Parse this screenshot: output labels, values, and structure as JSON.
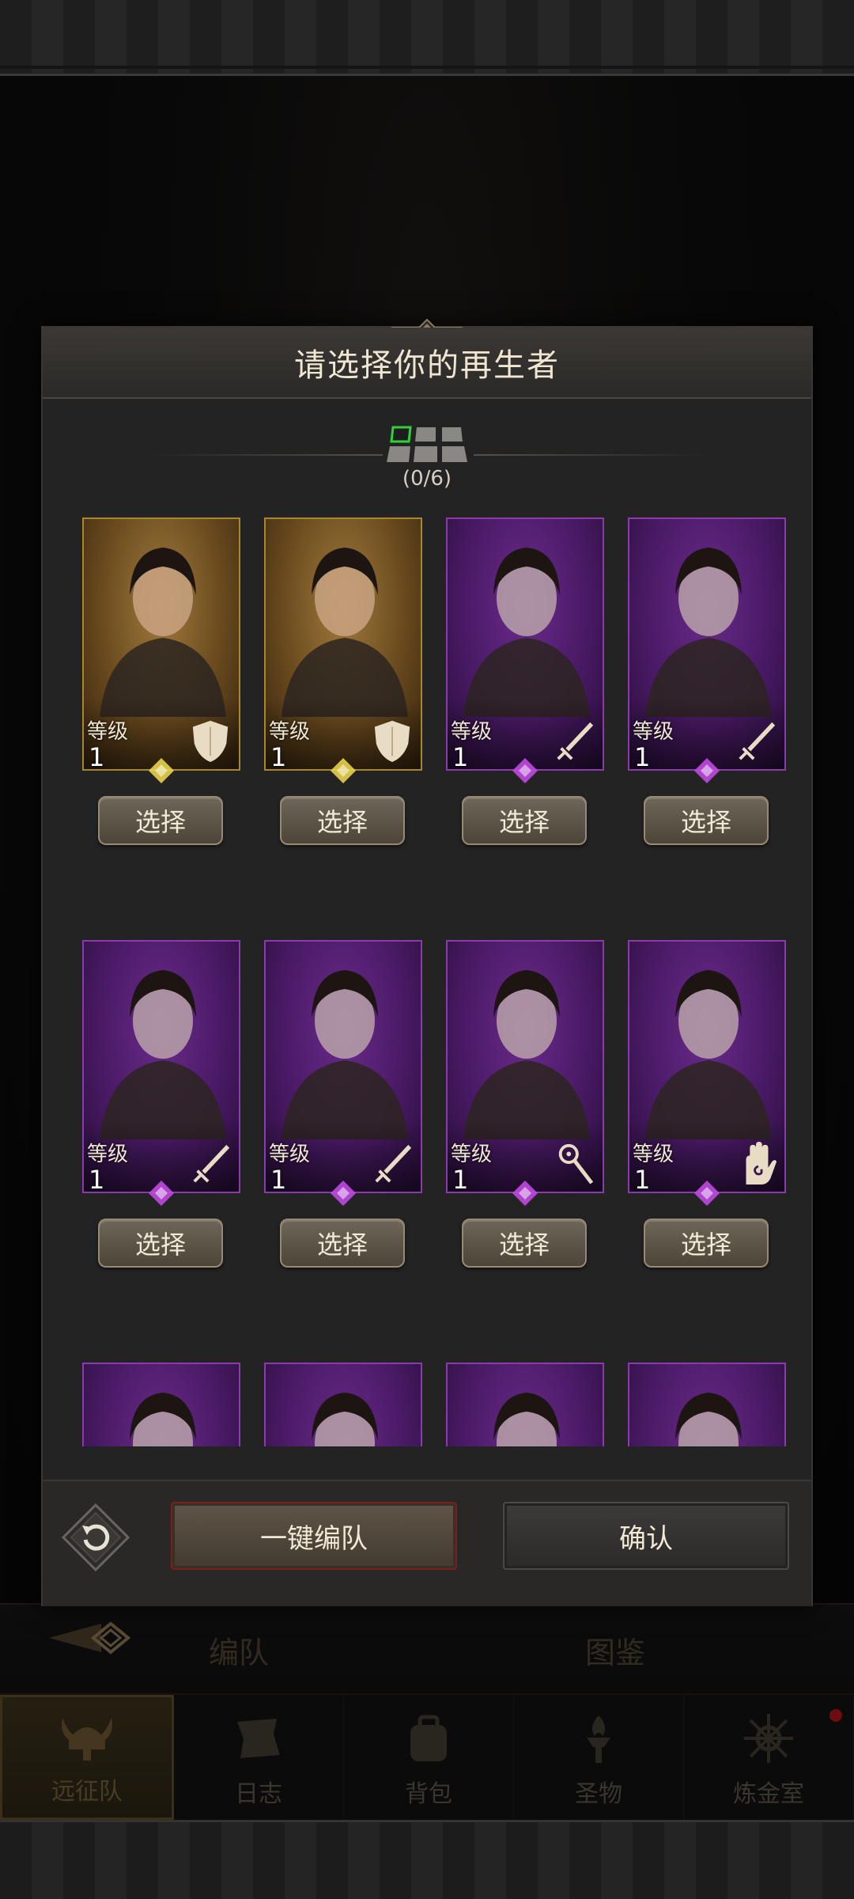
{
  "modal": {
    "title": "请选择你的再生者",
    "slot_count": "(0/6)",
    "select_label": "选择",
    "level_label": "等级",
    "auto_team_label": "一键编队",
    "confirm_label": "确认"
  },
  "heroes": [
    {
      "rarity": "gold",
      "level": "1",
      "class_icon": "shield-icon"
    },
    {
      "rarity": "gold",
      "level": "1",
      "class_icon": "shield-icon"
    },
    {
      "rarity": "purple",
      "level": "1",
      "class_icon": "sword-icon"
    },
    {
      "rarity": "purple",
      "level": "1",
      "class_icon": "sword-icon"
    },
    {
      "rarity": "purple",
      "level": "1",
      "class_icon": "sword-icon"
    },
    {
      "rarity": "purple",
      "level": "1",
      "class_icon": "sword-icon"
    },
    {
      "rarity": "purple",
      "level": "1",
      "class_icon": "staff-icon"
    },
    {
      "rarity": "purple",
      "level": "1",
      "class_icon": "palm-icon"
    },
    {
      "rarity": "purple",
      "class_icon": ""
    },
    {
      "rarity": "purple",
      "class_icon": ""
    },
    {
      "rarity": "purple",
      "class_icon": ""
    },
    {
      "rarity": "purple",
      "class_icon": ""
    }
  ],
  "tabs": {
    "team": "编队",
    "codex": "图鉴"
  },
  "nav": [
    {
      "label": "远征队",
      "icon": "viking-helmet-icon",
      "active": true
    },
    {
      "label": "日志",
      "icon": "scroll-icon",
      "active": false
    },
    {
      "label": "背包",
      "icon": "backpack-icon",
      "active": false
    },
    {
      "label": "圣物",
      "icon": "torch-icon",
      "active": false
    },
    {
      "label": "炼金室",
      "icon": "alchemy-icon",
      "active": false,
      "badge": true
    }
  ],
  "colors": {
    "gold_card": "#a8862c",
    "purple_card": "#8a3aaa",
    "auto_button_border": "#7a1e1e",
    "slot_active": "#2fd13a",
    "badge": "#a8141c"
  }
}
